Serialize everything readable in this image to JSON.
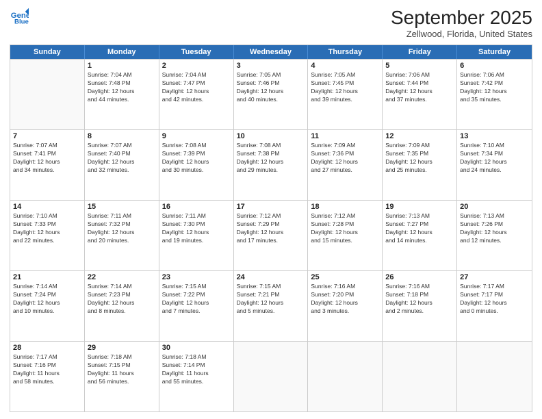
{
  "header": {
    "logo_line1": "General",
    "logo_line2": "Blue",
    "month": "September 2025",
    "location": "Zellwood, Florida, United States"
  },
  "days_of_week": [
    "Sunday",
    "Monday",
    "Tuesday",
    "Wednesday",
    "Thursday",
    "Friday",
    "Saturday"
  ],
  "weeks": [
    [
      {
        "day": "",
        "lines": []
      },
      {
        "day": "1",
        "lines": [
          "Sunrise: 7:04 AM",
          "Sunset: 7:48 PM",
          "Daylight: 12 hours",
          "and 44 minutes."
        ]
      },
      {
        "day": "2",
        "lines": [
          "Sunrise: 7:04 AM",
          "Sunset: 7:47 PM",
          "Daylight: 12 hours",
          "and 42 minutes."
        ]
      },
      {
        "day": "3",
        "lines": [
          "Sunrise: 7:05 AM",
          "Sunset: 7:46 PM",
          "Daylight: 12 hours",
          "and 40 minutes."
        ]
      },
      {
        "day": "4",
        "lines": [
          "Sunrise: 7:05 AM",
          "Sunset: 7:45 PM",
          "Daylight: 12 hours",
          "and 39 minutes."
        ]
      },
      {
        "day": "5",
        "lines": [
          "Sunrise: 7:06 AM",
          "Sunset: 7:44 PM",
          "Daylight: 12 hours",
          "and 37 minutes."
        ]
      },
      {
        "day": "6",
        "lines": [
          "Sunrise: 7:06 AM",
          "Sunset: 7:42 PM",
          "Daylight: 12 hours",
          "and 35 minutes."
        ]
      }
    ],
    [
      {
        "day": "7",
        "lines": [
          "Sunrise: 7:07 AM",
          "Sunset: 7:41 PM",
          "Daylight: 12 hours",
          "and 34 minutes."
        ]
      },
      {
        "day": "8",
        "lines": [
          "Sunrise: 7:07 AM",
          "Sunset: 7:40 PM",
          "Daylight: 12 hours",
          "and 32 minutes."
        ]
      },
      {
        "day": "9",
        "lines": [
          "Sunrise: 7:08 AM",
          "Sunset: 7:39 PM",
          "Daylight: 12 hours",
          "and 30 minutes."
        ]
      },
      {
        "day": "10",
        "lines": [
          "Sunrise: 7:08 AM",
          "Sunset: 7:38 PM",
          "Daylight: 12 hours",
          "and 29 minutes."
        ]
      },
      {
        "day": "11",
        "lines": [
          "Sunrise: 7:09 AM",
          "Sunset: 7:36 PM",
          "Daylight: 12 hours",
          "and 27 minutes."
        ]
      },
      {
        "day": "12",
        "lines": [
          "Sunrise: 7:09 AM",
          "Sunset: 7:35 PM",
          "Daylight: 12 hours",
          "and 25 minutes."
        ]
      },
      {
        "day": "13",
        "lines": [
          "Sunrise: 7:10 AM",
          "Sunset: 7:34 PM",
          "Daylight: 12 hours",
          "and 24 minutes."
        ]
      }
    ],
    [
      {
        "day": "14",
        "lines": [
          "Sunrise: 7:10 AM",
          "Sunset: 7:33 PM",
          "Daylight: 12 hours",
          "and 22 minutes."
        ]
      },
      {
        "day": "15",
        "lines": [
          "Sunrise: 7:11 AM",
          "Sunset: 7:32 PM",
          "Daylight: 12 hours",
          "and 20 minutes."
        ]
      },
      {
        "day": "16",
        "lines": [
          "Sunrise: 7:11 AM",
          "Sunset: 7:30 PM",
          "Daylight: 12 hours",
          "and 19 minutes."
        ]
      },
      {
        "day": "17",
        "lines": [
          "Sunrise: 7:12 AM",
          "Sunset: 7:29 PM",
          "Daylight: 12 hours",
          "and 17 minutes."
        ]
      },
      {
        "day": "18",
        "lines": [
          "Sunrise: 7:12 AM",
          "Sunset: 7:28 PM",
          "Daylight: 12 hours",
          "and 15 minutes."
        ]
      },
      {
        "day": "19",
        "lines": [
          "Sunrise: 7:13 AM",
          "Sunset: 7:27 PM",
          "Daylight: 12 hours",
          "and 14 minutes."
        ]
      },
      {
        "day": "20",
        "lines": [
          "Sunrise: 7:13 AM",
          "Sunset: 7:26 PM",
          "Daylight: 12 hours",
          "and 12 minutes."
        ]
      }
    ],
    [
      {
        "day": "21",
        "lines": [
          "Sunrise: 7:14 AM",
          "Sunset: 7:24 PM",
          "Daylight: 12 hours",
          "and 10 minutes."
        ]
      },
      {
        "day": "22",
        "lines": [
          "Sunrise: 7:14 AM",
          "Sunset: 7:23 PM",
          "Daylight: 12 hours",
          "and 8 minutes."
        ]
      },
      {
        "day": "23",
        "lines": [
          "Sunrise: 7:15 AM",
          "Sunset: 7:22 PM",
          "Daylight: 12 hours",
          "and 7 minutes."
        ]
      },
      {
        "day": "24",
        "lines": [
          "Sunrise: 7:15 AM",
          "Sunset: 7:21 PM",
          "Daylight: 12 hours",
          "and 5 minutes."
        ]
      },
      {
        "day": "25",
        "lines": [
          "Sunrise: 7:16 AM",
          "Sunset: 7:20 PM",
          "Daylight: 12 hours",
          "and 3 minutes."
        ]
      },
      {
        "day": "26",
        "lines": [
          "Sunrise: 7:16 AM",
          "Sunset: 7:18 PM",
          "Daylight: 12 hours",
          "and 2 minutes."
        ]
      },
      {
        "day": "27",
        "lines": [
          "Sunrise: 7:17 AM",
          "Sunset: 7:17 PM",
          "Daylight: 12 hours",
          "and 0 minutes."
        ]
      }
    ],
    [
      {
        "day": "28",
        "lines": [
          "Sunrise: 7:17 AM",
          "Sunset: 7:16 PM",
          "Daylight: 11 hours",
          "and 58 minutes."
        ]
      },
      {
        "day": "29",
        "lines": [
          "Sunrise: 7:18 AM",
          "Sunset: 7:15 PM",
          "Daylight: 11 hours",
          "and 56 minutes."
        ]
      },
      {
        "day": "30",
        "lines": [
          "Sunrise: 7:18 AM",
          "Sunset: 7:14 PM",
          "Daylight: 11 hours",
          "and 55 minutes."
        ]
      },
      {
        "day": "",
        "lines": []
      },
      {
        "day": "",
        "lines": []
      },
      {
        "day": "",
        "lines": []
      },
      {
        "day": "",
        "lines": []
      }
    ]
  ]
}
